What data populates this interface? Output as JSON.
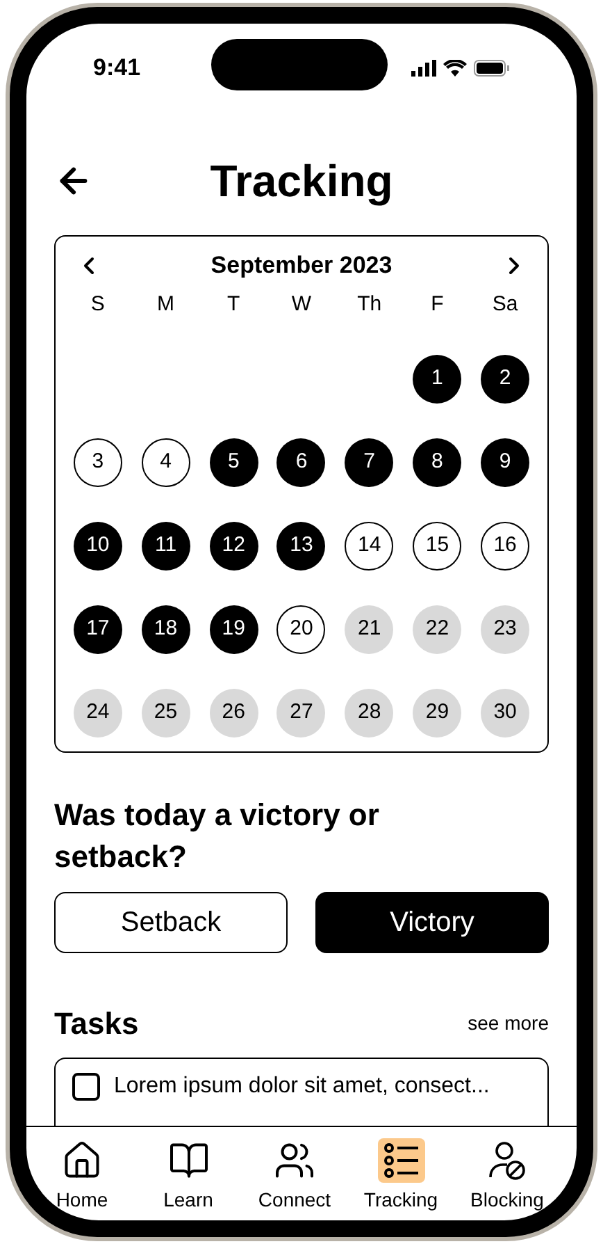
{
  "status_bar": {
    "time": "9:41"
  },
  "header": {
    "title": "Tracking"
  },
  "calendar": {
    "month": "September 2023",
    "weekdays": [
      "S",
      "M",
      "T",
      "W",
      "Th",
      "F",
      "Sa"
    ],
    "weeks": [
      {
        "days": [
          {
            "label": "1",
            "kind": "victory"
          },
          {
            "label": "2",
            "kind": "victory"
          }
        ]
      },
      {
        "days": [
          {
            "label": "3",
            "kind": "setback"
          },
          {
            "label": "4",
            "kind": "setback"
          },
          {
            "label": "5",
            "kind": "victory"
          },
          {
            "label": "6",
            "kind": "victory"
          },
          {
            "label": "7",
            "kind": "victory"
          },
          {
            "label": "8",
            "kind": "victory"
          },
          {
            "label": "9",
            "kind": "victory"
          }
        ]
      },
      {
        "days": [
          {
            "label": "10",
            "kind": "victory"
          },
          {
            "label": "11",
            "kind": "victory"
          },
          {
            "label": "12",
            "kind": "victory"
          },
          {
            "label": "13",
            "kind": "victory"
          },
          {
            "label": "14",
            "kind": "setback"
          },
          {
            "label": "15",
            "kind": "setback"
          },
          {
            "label": "16",
            "kind": "setback"
          }
        ]
      },
      {
        "days": [
          {
            "label": "17",
            "kind": "victory"
          },
          {
            "label": "18",
            "kind": "victory"
          },
          {
            "label": "19",
            "kind": "victory"
          },
          {
            "label": "20",
            "kind": "setback"
          },
          {
            "label": "21",
            "kind": "future"
          },
          {
            "label": "22",
            "kind": "future"
          },
          {
            "label": "23",
            "kind": "future"
          }
        ]
      },
      {
        "days": [
          {
            "label": "24",
            "kind": "future"
          },
          {
            "label": "25",
            "kind": "future"
          },
          {
            "label": "26",
            "kind": "future"
          },
          {
            "label": "27",
            "kind": "future"
          },
          {
            "label": "28",
            "kind": "future"
          },
          {
            "label": "29",
            "kind": "future"
          },
          {
            "label": "30",
            "kind": "future"
          }
        ]
      }
    ]
  },
  "question": "Was today a victory or setback?",
  "choices": [
    {
      "label": "Setback",
      "selected": false
    },
    {
      "label": "Victory",
      "selected": true
    }
  ],
  "tasks": {
    "title": "Tasks",
    "see_more": "see more",
    "items": [
      {
        "text": "Lorem ipsum dolor sit amet, consect...",
        "checked": false
      }
    ]
  },
  "nav": [
    {
      "label": "Home",
      "selected": false
    },
    {
      "label": "Learn",
      "selected": false
    },
    {
      "label": "Connect",
      "selected": false
    },
    {
      "label": "Tracking",
      "selected": true
    },
    {
      "label": "Blocking",
      "selected": false
    }
  ]
}
